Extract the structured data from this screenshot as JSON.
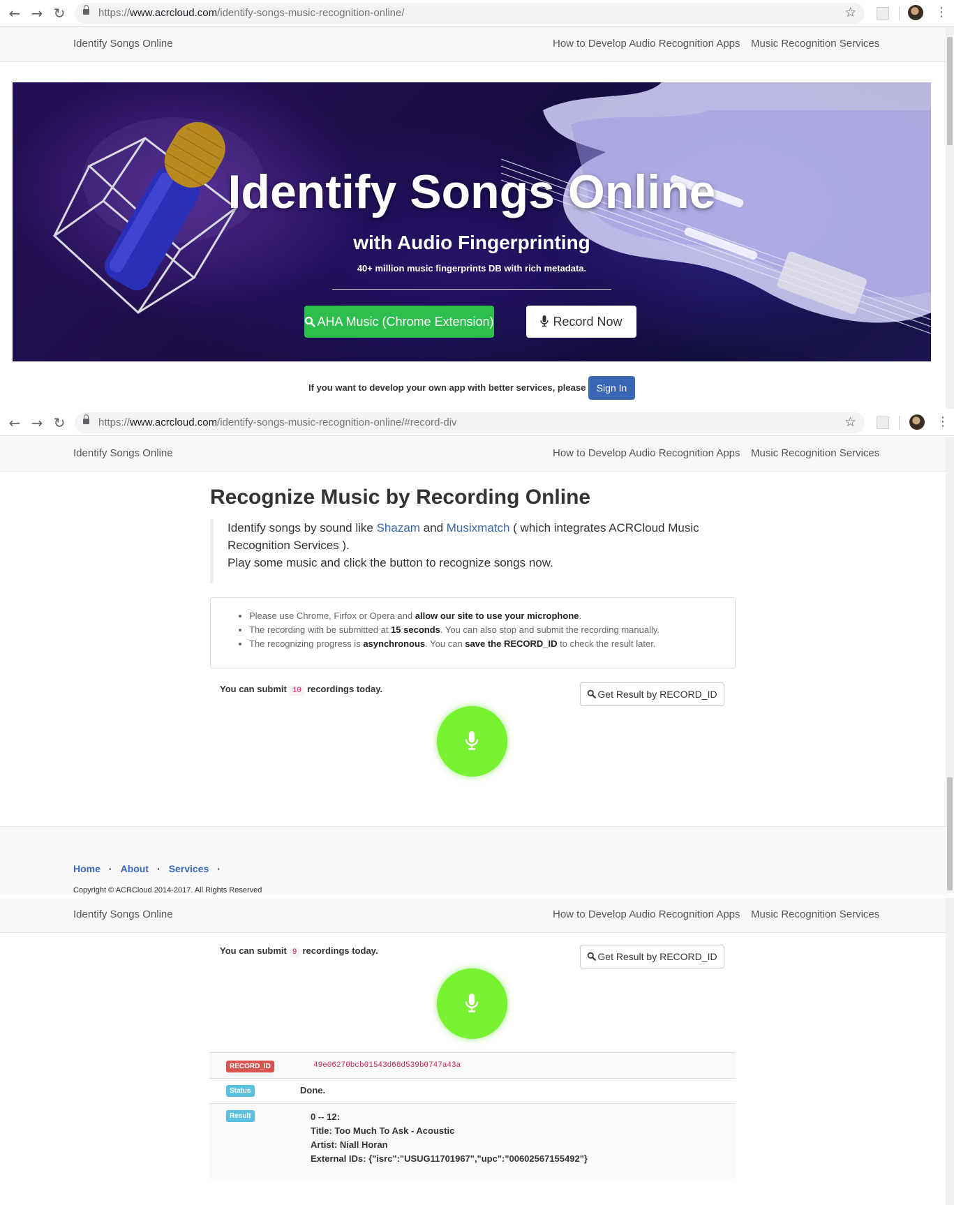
{
  "browser": [
    {
      "url_prefix": "https://",
      "url_domain": "www.acrcloud.com",
      "url_path": "/identify-songs-music-recognition-online/"
    },
    {
      "url_prefix": "https://",
      "url_domain": "www.acrcloud.com",
      "url_path": "/identify-songs-music-recognition-online/#record-div"
    }
  ],
  "navbar": {
    "brand": "Identify Songs Online",
    "links": [
      "How to Develop Audio Recognition Apps",
      "Music Recognition Services"
    ]
  },
  "hero": {
    "title": "Identify Songs Online",
    "subtitle": "with Audio Fingerprinting",
    "tagline": "40+ million music fingerprints DB with rich metadata.",
    "btn_extension": "AHA Music (Chrome Extension)",
    "btn_record": "Record Now"
  },
  "signin": {
    "text": "If you want to develop your own app with better services, please",
    "button": "Sign In"
  },
  "recognize": {
    "title": "Recognize Music by Recording Online",
    "quote_part1": "Identify songs by sound like ",
    "link_shazam": "Shazam",
    "quote_and": " and ",
    "link_musixmatch": "Musixmatch",
    "quote_part2": " ( which integrates ACRCloud Music Recognition Services ).",
    "quote_line2": "Play some music and click the button to recognize songs now.",
    "notes": [
      {
        "pre": "Please use Chrome, Firfox or Opera and ",
        "bold": "allow our site to use your microphone",
        "post": "."
      },
      {
        "pre": "The recording with be submitted at ",
        "bold": "15 seconds",
        "post": ". You can also stop and submit the recording manually."
      },
      {
        "pre": "The recognizing progress is ",
        "bold": "asynchronous",
        "mid": ". You can ",
        "bold2": "save the RECORD_ID",
        "post": " to check the result later."
      }
    ],
    "submit_pre": "You can submit",
    "submit_post": "recordings today.",
    "submit_count_1": "10",
    "submit_count_2": "9",
    "btn_get_result": "Get Result by RECORD_ID"
  },
  "footer": {
    "links": [
      "Home",
      "About",
      "Services"
    ],
    "copyright": "Copyright © ACRCloud 2014-2017. All Rights Reserved"
  },
  "result": {
    "record_id_label": "RECORD_ID",
    "record_id": "49e06270bcb01543d68d539b0747a43a",
    "status_label": "Status",
    "status": "Done.",
    "result_label": "Result",
    "range": "0 -- 12:",
    "title": "Title: Too Much To Ask - Acoustic",
    "artist": "Artist: Niall Horan",
    "external_ids": "External IDs: {\"isrc\":\"USUG11701967\",\"upc\":\"00602567155492\"}"
  },
  "colors": {
    "accent_blue": "#3a67b5",
    "green_button": "#2dbe4e",
    "mic_green": "#76f22e",
    "label_red": "#d9534f",
    "label_blue": "#5bc0de"
  },
  "icons": [
    "back-icon",
    "forward-icon",
    "reload-icon",
    "lock-icon",
    "star-icon",
    "menu-icon",
    "search-icon",
    "microphone-icon"
  ]
}
